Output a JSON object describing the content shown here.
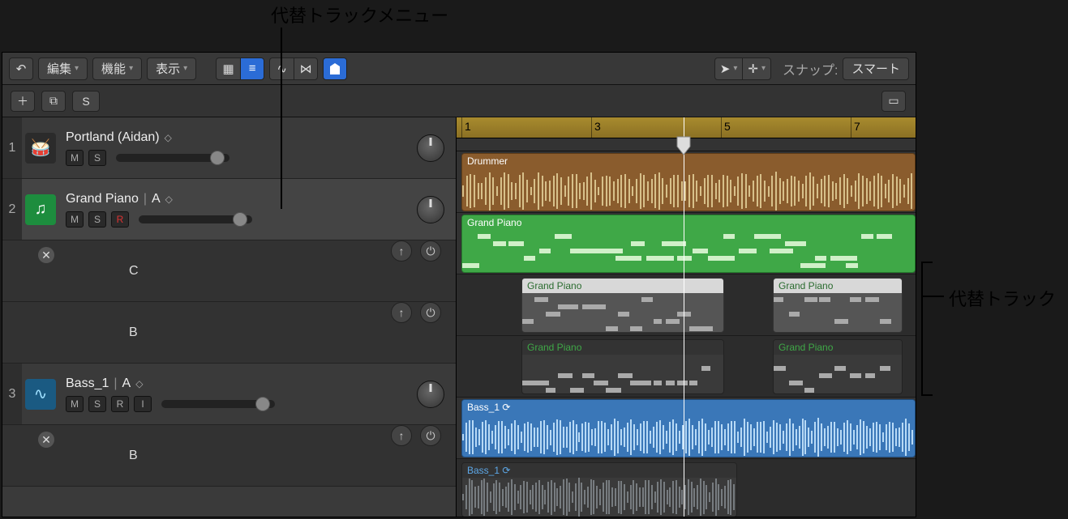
{
  "callouts": {
    "alt_menu": "代替トラックメニュー",
    "alt_tracks": "代替トラック"
  },
  "toolbar": {
    "edit": "編集",
    "function": "機能",
    "view": "表示",
    "snap_label": "スナップ:",
    "snap_value": "スマート"
  },
  "subbar": {
    "solo": "S"
  },
  "ruler": {
    "bars": [
      "1",
      "3",
      "5",
      "7"
    ]
  },
  "tracks": [
    {
      "num": "1",
      "name": "Portland (Aidan)",
      "alt_suffix": "",
      "icon": "drum",
      "buttons": {
        "M": "M",
        "S": "S"
      },
      "region_label": "Drummer",
      "alts": []
    },
    {
      "num": "2",
      "name": "Grand Piano",
      "alt_suffix": "A",
      "icon": "midi",
      "buttons": {
        "M": "M",
        "S": "S",
        "R": "R"
      },
      "region_label": "Grand Piano",
      "alts": [
        {
          "label": "C",
          "region_label": "Grand Piano",
          "region2_label": "Grand Piano"
        },
        {
          "label": "B",
          "region_label": "Grand Piano",
          "region2_label": "Grand Piano"
        }
      ]
    },
    {
      "num": "3",
      "name": "Bass_1",
      "alt_suffix": "A",
      "icon": "audio",
      "buttons": {
        "M": "M",
        "S": "S",
        "R": "R",
        "I": "I"
      },
      "region_label": "Bass_1",
      "alts": [
        {
          "label": "B",
          "region_label": "Bass_1"
        }
      ]
    }
  ]
}
